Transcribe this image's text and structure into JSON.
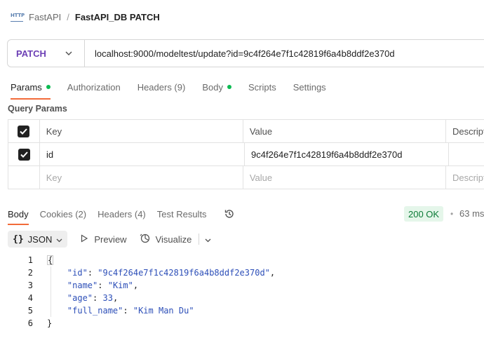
{
  "breadcrumb": {
    "badge": "HTTP",
    "parent": "FastAPI",
    "separator": "/",
    "current": "FastAPI_DB PATCH"
  },
  "request": {
    "method": "PATCH",
    "url": "localhost:9000/modeltest/update?id=9c4f264e7f1c42819f6a4b8ddf2e370d"
  },
  "request_tabs": [
    {
      "label": "Params",
      "dot": true
    },
    {
      "label": "Authorization"
    },
    {
      "label": "Headers (9)"
    },
    {
      "label": "Body",
      "dot": true
    },
    {
      "label": "Scripts"
    },
    {
      "label": "Settings"
    }
  ],
  "query_params": {
    "title": "Query Params",
    "headers": {
      "key": "Key",
      "value": "Value",
      "description": "Description"
    },
    "rows": [
      {
        "checked": true,
        "key": "id",
        "value": "9c4f264e7f1c42819f6a4b8ddf2e370d",
        "description": ""
      }
    ],
    "placeholder": {
      "key": "Key",
      "value": "Value",
      "description": "Description"
    }
  },
  "response": {
    "tabs": [
      "Body",
      "Cookies (2)",
      "Headers (4)",
      "Test Results"
    ],
    "status": "200 OK",
    "separator": "•",
    "time": "63 ms",
    "format": "JSON",
    "format_braces": "{}",
    "preview": "Preview",
    "visualize": "Visualize",
    "body_lines": [
      {
        "ln": "1",
        "text": "{"
      },
      {
        "ln": "2",
        "key": "\"id\"",
        "value": "\"9c4f264e7f1c42819f6a4b8ddf2e370d\"",
        "trail": ","
      },
      {
        "ln": "3",
        "key": "\"name\"",
        "value": "\"Kim\"",
        "trail": ","
      },
      {
        "ln": "4",
        "key": "\"age\"",
        "value": "33",
        "trail": ","
      },
      {
        "ln": "5",
        "key": "\"full_name\"",
        "value": "\"Kim Man Du\"",
        "trail": ""
      },
      {
        "ln": "6",
        "text": "}"
      }
    ]
  },
  "colors": {
    "method": "#6c3fb5",
    "accent": "#f26b3a",
    "dot": "#0cbb52",
    "status_bg": "#e5f6ea",
    "status_text": "#0a7a35",
    "json_value": "#2d4fb8"
  }
}
